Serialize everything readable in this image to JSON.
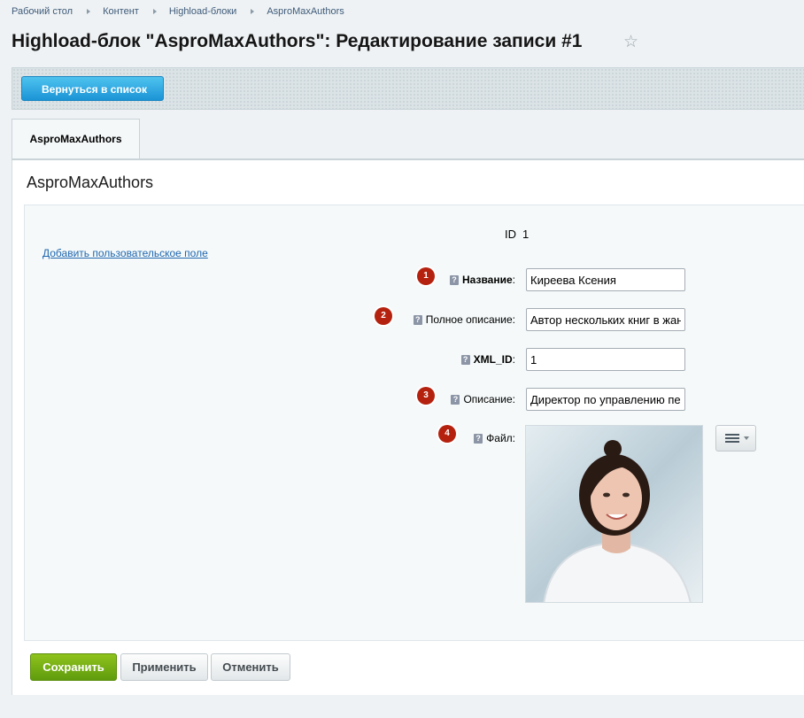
{
  "breadcrumb": {
    "items": [
      "Рабочий стол",
      "Контент",
      "Highload-блоки",
      "AsproMaxAuthors"
    ]
  },
  "page": {
    "title": "Highload-блок \"AsproMaxAuthors\": Редактирование записи #1"
  },
  "toolbar": {
    "back_label": "Вернуться в список"
  },
  "tabs": [
    {
      "label": "AsproMaxAuthors",
      "active": true
    }
  ],
  "panel": {
    "heading": "AsproMaxAuthors",
    "add_field_link": "Добавить пользовательское поле",
    "id_label": "ID",
    "id_value": "1"
  },
  "form": {
    "fields": [
      {
        "badge": "1",
        "label": "Название",
        "suffix": ":",
        "required": true,
        "value": "Киреева Ксения"
      },
      {
        "badge": "2",
        "label": "Полное описание",
        "suffix": ":",
        "required": false,
        "value": "Автор нескольких книг в жан"
      },
      {
        "badge": "",
        "label": "XML_ID",
        "suffix": ":",
        "required": true,
        "value": "1"
      },
      {
        "badge": "3",
        "label": "Описание",
        "suffix": ":",
        "required": false,
        "value": "Директор по управлению пе"
      },
      {
        "badge": "4",
        "label": "Файл",
        "suffix": ":",
        "required": false,
        "value": ""
      }
    ],
    "help_glyph": "?"
  },
  "footer": {
    "save_label": "Сохранить",
    "apply_label": "Применить",
    "cancel_label": "Отменить"
  },
  "colors": {
    "accent_blue": "#1b94d6",
    "save_green": "#6aa514",
    "badge_red": "#b4220f",
    "link": "#2067b0"
  }
}
